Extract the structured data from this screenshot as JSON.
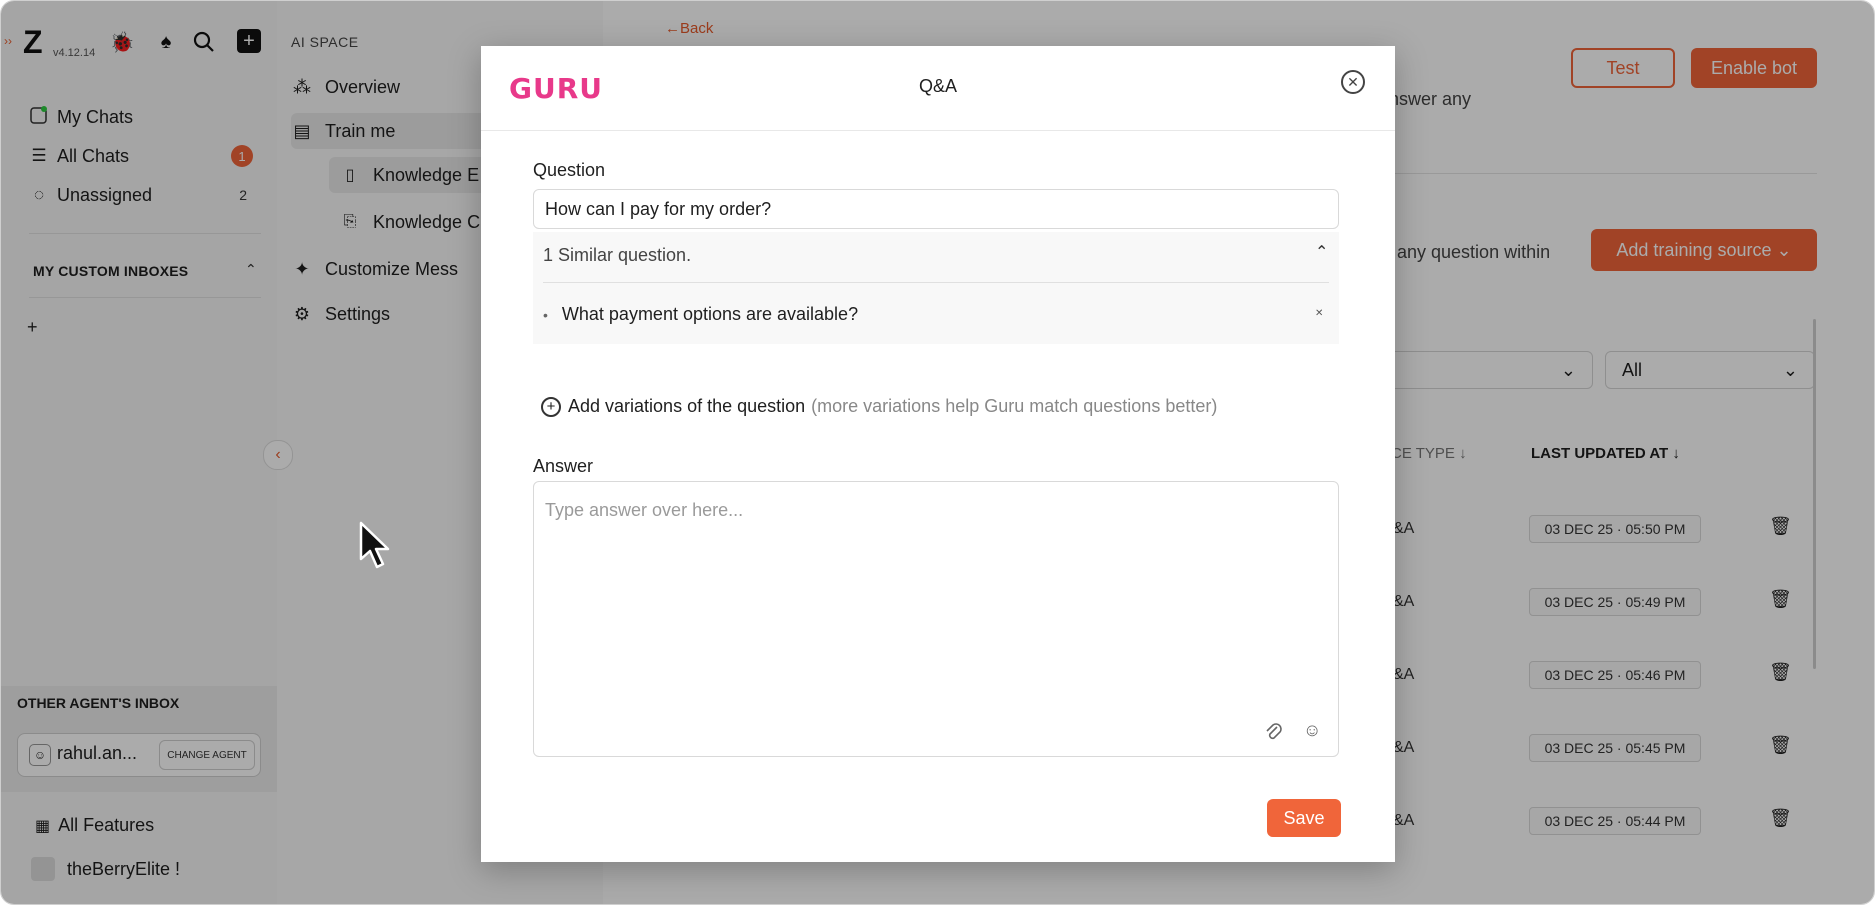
{
  "rail": {
    "version": "v4.12.14",
    "nav": [
      {
        "label": "My Chats",
        "icon": "chat-avatar-icon"
      },
      {
        "label": "All Chats",
        "icon": "list-icon",
        "badge": "1"
      },
      {
        "label": "Unassigned",
        "icon": "chat-bubble-icon",
        "count": "2"
      }
    ],
    "custom_inboxes_label": "MY CUSTOM INBOXES",
    "other_inbox_label": "OTHER AGENT'S INBOX",
    "agent_name": "rahul.an...",
    "change_agent_label": "CHANGE AGENT",
    "all_features": "All Features",
    "workspace": "theBerryElite !"
  },
  "ai_space": {
    "label": "AI SPACE",
    "items": [
      {
        "label": "Overview"
      },
      {
        "label": "Train me"
      },
      {
        "label": "Knowledge E"
      },
      {
        "label": "Knowledge C"
      },
      {
        "label": "Customize Mess"
      },
      {
        "label": "Settings"
      }
    ]
  },
  "main": {
    "back": "←Back",
    "test_label": "Test",
    "enable_label": "Enable bot",
    "frag_top": "nswer any",
    "frag_mid": "any question within",
    "add_source_label": "Add training source ⌄",
    "filter_value": "All",
    "col_type": "CE TYPE ↓",
    "col_updated": "LAST UPDATED AT ↓",
    "rows": [
      {
        "type": "&A",
        "date": "03 DEC 25 · 05:50 PM"
      },
      {
        "type": "&A",
        "date": "03 DEC 25 · 05:49 PM"
      },
      {
        "type": "&A",
        "date": "03 DEC 25 · 05:46 PM"
      },
      {
        "type": "&A",
        "date": "03 DEC 25 · 05:45 PM"
      },
      {
        "type": "&A",
        "date": "03 DEC 25 · 05:44 PM"
      }
    ]
  },
  "modal": {
    "brand": "GURU",
    "title": "Q&A",
    "question_label": "Question",
    "question_value": "How can I pay for my order?",
    "similar_header": "1 Similar question.",
    "similar_items": [
      "What payment options are available?"
    ],
    "add_variations": "Add variations of the question",
    "add_variations_hint": "(more variations help Guru match questions better)",
    "answer_label": "Answer",
    "answer_placeholder": "Type answer over here...",
    "save_label": "Save"
  },
  "colors": {
    "accent": "#f0653a",
    "brand_pink": "#e8398a"
  }
}
